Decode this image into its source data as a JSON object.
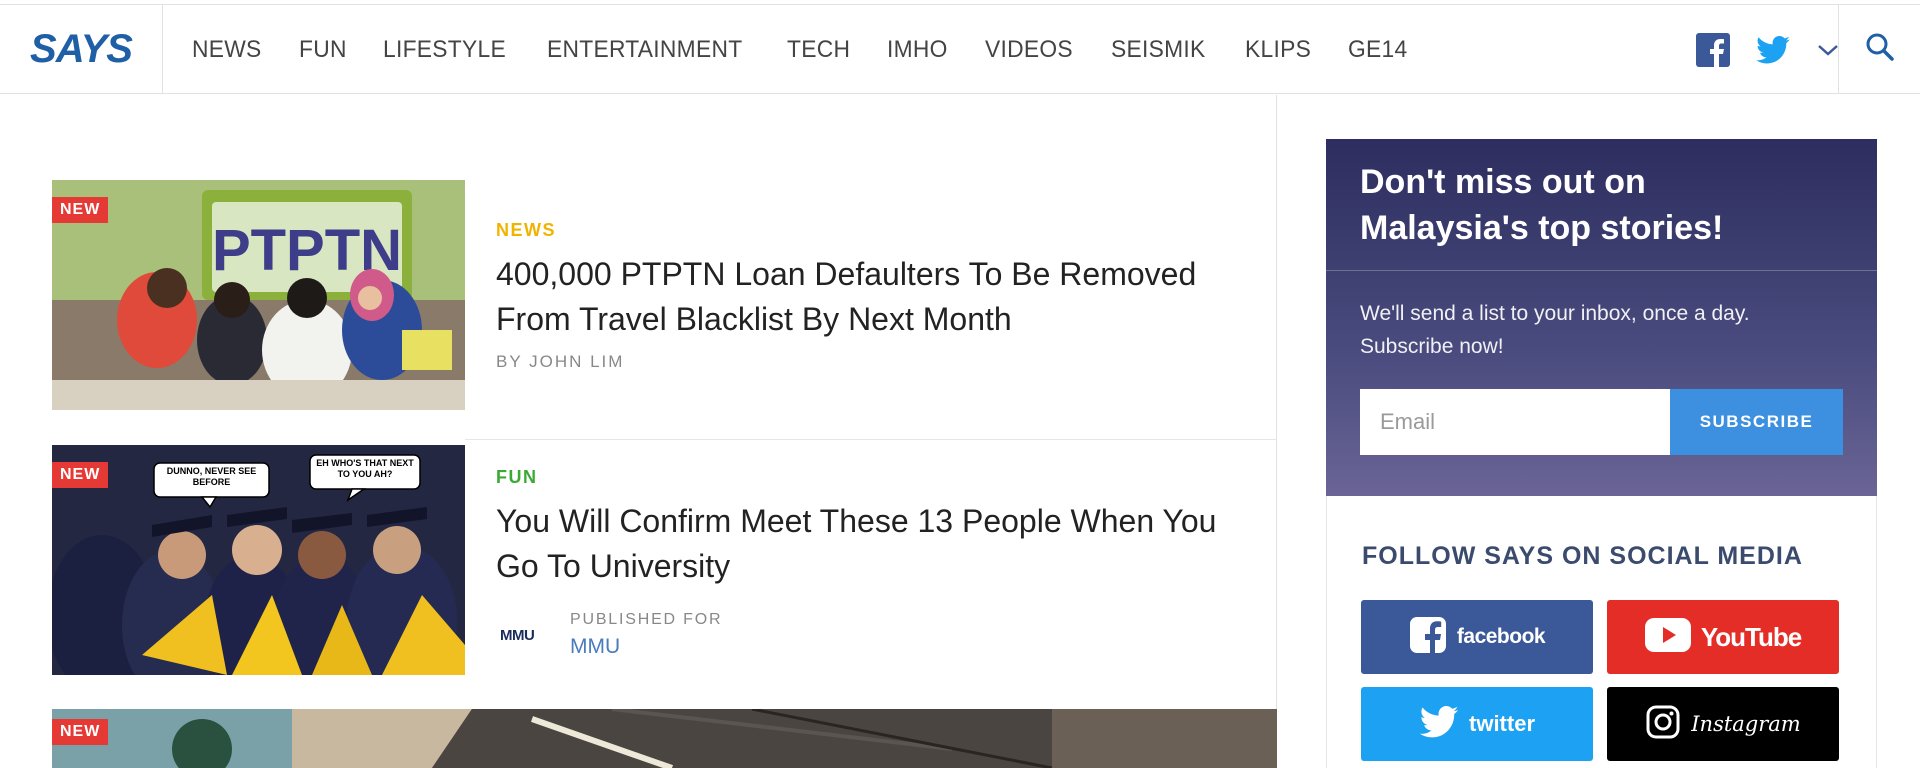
{
  "header": {
    "logo": "SAYS",
    "nav": [
      "NEWS",
      "FUN",
      "LIFESTYLE",
      "ENTERTAINMENT",
      "TECH",
      "IMHO",
      "VIDEOS",
      "SEISMIK",
      "KLIPS",
      "GE14"
    ],
    "icons": [
      "facebook-icon",
      "twitter-icon",
      "chevron-down-icon",
      "search-icon"
    ]
  },
  "articles": [
    {
      "badge": "NEW",
      "category": "NEWS",
      "category_color": "#f0b400",
      "title": "400,000 PTPTN Loan Defaulters To Be Removed From Travel Blacklist By Next Month",
      "byline": "BY JOHN LIM",
      "image_text": "PTPTN"
    },
    {
      "badge": "NEW",
      "category": "FUN",
      "category_color": "#3aaa35",
      "title": "You Will Confirm Meet These 13 People When You Go To University",
      "published_label": "PUBLISHED FOR",
      "sponsor": "MMU",
      "sponsor_logo": "MMU",
      "bubble1": "DUNNO, NEVER SEE BEFORE",
      "bubble2": "EH WHO'S THAT NEXT TO YOU AH?"
    },
    {
      "badge": "NEW"
    }
  ],
  "sidebar": {
    "newsletter": {
      "heading": "Don't miss out on Malaysia's top stories!",
      "sub": "We'll send a list to your inbox, once a day. Subscribe now!",
      "email_placeholder": "Email",
      "button": "SUBSCRIBE"
    },
    "follow": {
      "title": "FOLLOW SAYS ON SOCIAL MEDIA",
      "buttons": [
        {
          "label": "facebook",
          "color": "#3b5998"
        },
        {
          "label": "YouTube",
          "color": "#e52d27"
        },
        {
          "label": "twitter",
          "color": "#1da1f2"
        },
        {
          "label": "Instagram",
          "color": "#000000"
        }
      ]
    }
  }
}
